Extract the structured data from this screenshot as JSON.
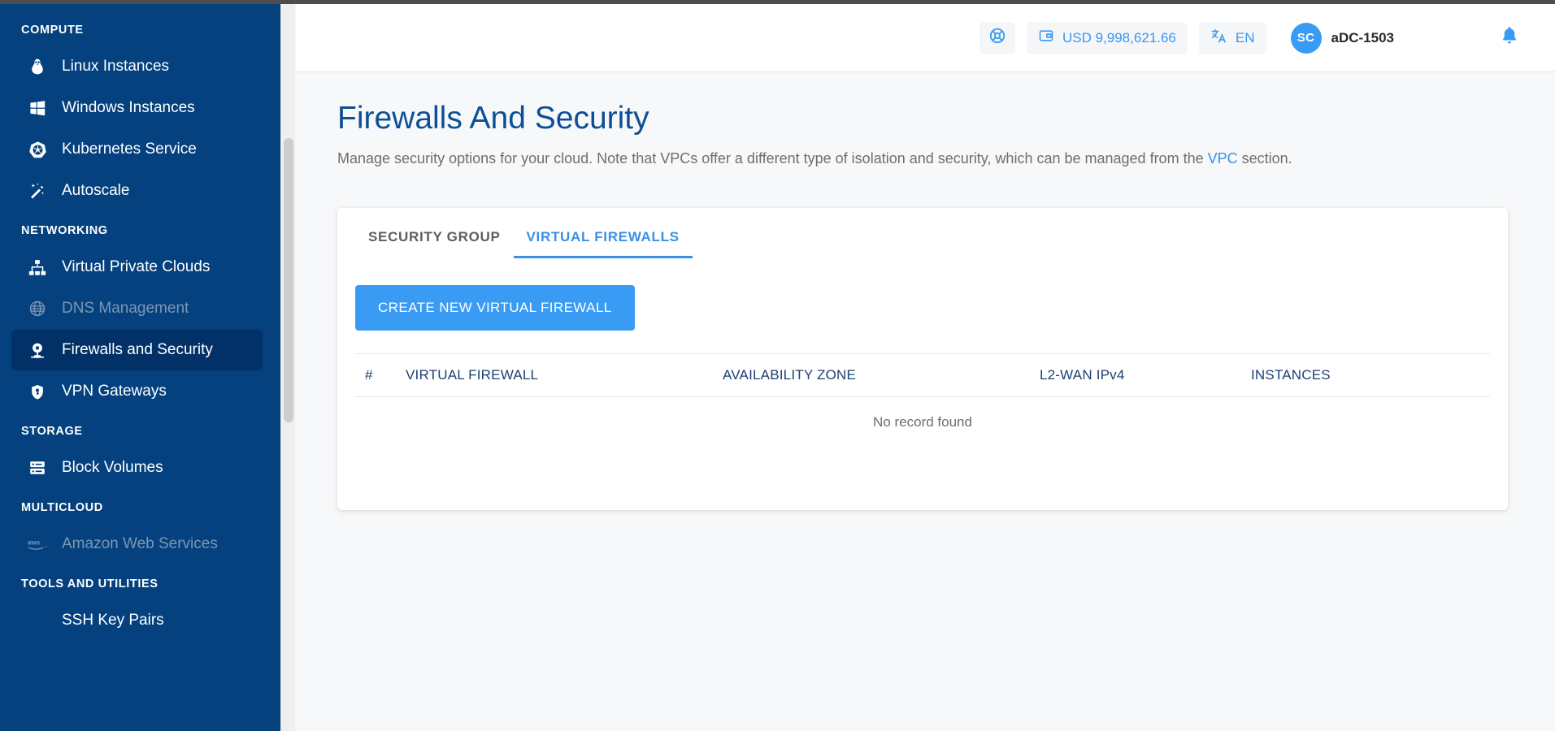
{
  "sidebar": {
    "sections": [
      {
        "title": "COMPUTE",
        "items": [
          {
            "label": "Linux Instances",
            "icon": "linux-penguin-icon",
            "state": "normal"
          },
          {
            "label": "Windows Instances",
            "icon": "windows-icon",
            "state": "normal"
          },
          {
            "label": "Kubernetes Service",
            "icon": "kubernetes-icon",
            "state": "normal"
          },
          {
            "label": "Autoscale",
            "icon": "magic-wand-icon",
            "state": "normal"
          }
        ]
      },
      {
        "title": "NETWORKING",
        "items": [
          {
            "label": "Virtual Private Clouds",
            "icon": "network-topology-icon",
            "state": "normal"
          },
          {
            "label": "DNS Management",
            "icon": "globe-icon",
            "state": "disabled"
          },
          {
            "label": "Firewalls and Security",
            "icon": "firewall-shield-icon",
            "state": "active"
          },
          {
            "label": "VPN Gateways",
            "icon": "shield-key-icon",
            "state": "normal"
          }
        ]
      },
      {
        "title": "STORAGE",
        "items": [
          {
            "label": "Block Volumes",
            "icon": "server-stack-icon",
            "state": "normal"
          }
        ]
      },
      {
        "title": "MULTICLOUD",
        "items": [
          {
            "label": "Amazon Web Services",
            "icon": "aws-icon",
            "state": "disabled"
          }
        ]
      },
      {
        "title": "TOOLS AND UTILITIES",
        "items": [
          {
            "label": "SSH Key Pairs",
            "icon": "",
            "state": "normal"
          }
        ]
      }
    ]
  },
  "header": {
    "support_icon": "life-ring-icon",
    "balance_icon": "wallet-icon",
    "balance": "USD 9,998,621.66",
    "language_icon": "translate-icon",
    "language": "EN",
    "avatar_initials": "SC",
    "user_name": "aDC-1503",
    "notification_icon": "bell-icon"
  },
  "main": {
    "title": "Firewalls And Security",
    "description_before": "Manage security options for your cloud. Note that VPCs offer a different type of isolation and security, which can be managed from the ",
    "description_link": "VPC",
    "description_after": " section."
  },
  "card": {
    "tabs": [
      {
        "label": "SECURITY GROUP",
        "active": false
      },
      {
        "label": "VIRTUAL FIREWALLS",
        "active": true
      }
    ],
    "create_button": "CREATE NEW VIRTUAL FIREWALL",
    "table": {
      "columns": [
        "#",
        "VIRTUAL FIREWALL",
        "AVAILABILITY ZONE",
        "L2-WAN IPv4",
        "INSTANCES"
      ],
      "rows": [],
      "empty_text": "No record found"
    }
  },
  "colors": {
    "sidebar_bg": "#04417e",
    "sidebar_active_bg": "#013166",
    "accent_blue": "#3a9bf4",
    "title_blue": "#0d4f96",
    "table_header_blue": "#1c3f72"
  }
}
